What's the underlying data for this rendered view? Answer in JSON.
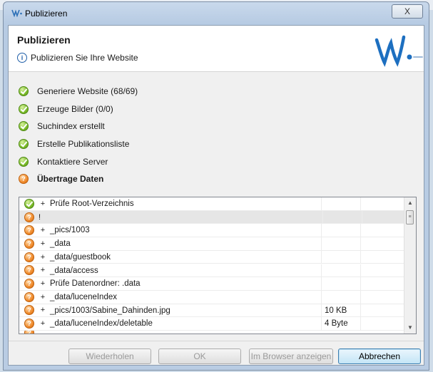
{
  "window": {
    "title": "Publizieren",
    "close_label": "X"
  },
  "header": {
    "title": "Publizieren",
    "subtitle": "Publizieren Sie Ihre Website"
  },
  "steps": [
    {
      "label": "Generiere Website (68/69)",
      "status": "done"
    },
    {
      "label": "Erzeuge Bilder (0/0)",
      "status": "done"
    },
    {
      "label": "Suchindex erstellt",
      "status": "done"
    },
    {
      "label": "Erstelle Publikationsliste",
      "status": "done"
    },
    {
      "label": "Kontaktiere Server",
      "status": "done"
    },
    {
      "label": "Übertrage Daten",
      "status": "in-progress"
    }
  ],
  "transfer": {
    "rows": [
      {
        "status": "done",
        "sign": "+",
        "path": "Prüfe Root-Verzeichnis",
        "size": ""
      },
      {
        "status": "pending",
        "sign": "!",
        "path": "",
        "size": ""
      },
      {
        "status": "pending",
        "sign": "+",
        "path": "_pics/1003",
        "size": ""
      },
      {
        "status": "pending",
        "sign": "+",
        "path": "_data",
        "size": ""
      },
      {
        "status": "pending",
        "sign": "+",
        "path": "_data/guestbook",
        "size": ""
      },
      {
        "status": "pending",
        "sign": "+",
        "path": "_data/access",
        "size": ""
      },
      {
        "status": "pending",
        "sign": "+",
        "path": "Prüfe Datenordner: .data",
        "size": ""
      },
      {
        "status": "pending",
        "sign": "+",
        "path": "_data/luceneIndex",
        "size": ""
      },
      {
        "status": "pending",
        "sign": "+",
        "path": "_pics/1003/Sabine_Dahinden.jpg",
        "size": "10 KB"
      },
      {
        "status": "pending",
        "sign": "+",
        "path": "_data/luceneIndex/deletable",
        "size": "4 Byte"
      }
    ]
  },
  "buttons": {
    "retry": "Wiederholen",
    "ok": "OK",
    "browser": "Im Browser anzeigen",
    "cancel": "Abbrechen"
  },
  "colors": {
    "done": "#7cbc2a",
    "pending": "#f08c2e",
    "accent": "#3c7fb1"
  }
}
